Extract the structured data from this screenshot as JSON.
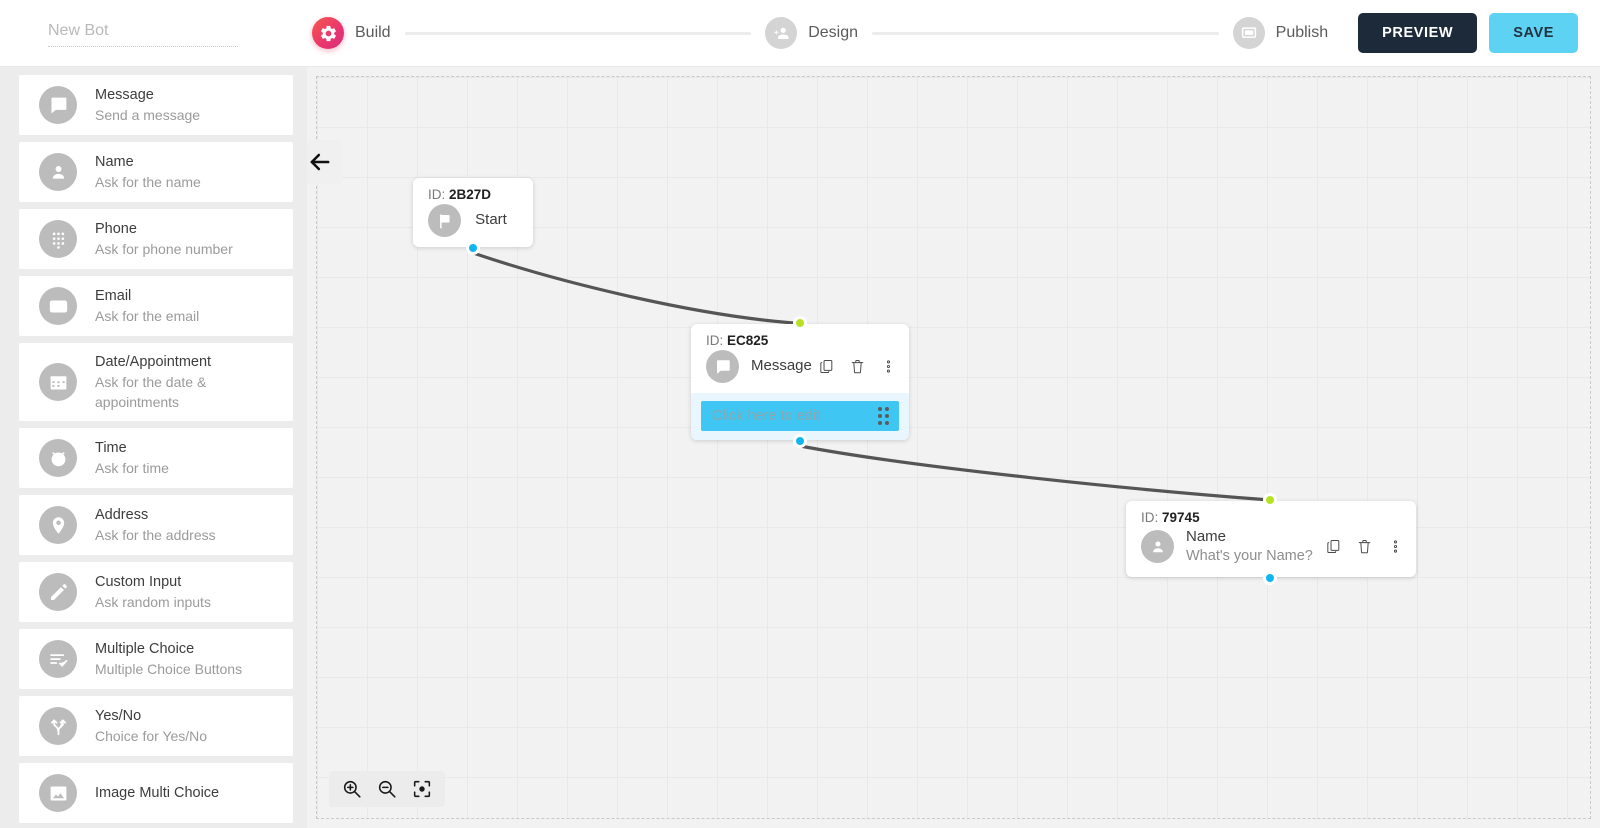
{
  "header": {
    "bot_name_value": "",
    "bot_name_placeholder": "New Bot",
    "steps": [
      {
        "label": "Build",
        "icon": "gear-icon",
        "state": "active"
      },
      {
        "label": "Design",
        "icon": "people-add-icon",
        "state": "idle"
      },
      {
        "label": "Publish",
        "icon": "monitor-icon",
        "state": "idle"
      }
    ],
    "preview_label": "PREVIEW",
    "save_label": "SAVE",
    "accent_active": "#e7365f",
    "preview_bg": "#1d2a3a",
    "save_bg": "#5dd2f3"
  },
  "sidebar": {
    "items": [
      {
        "title": "Message",
        "sub": "Send a message",
        "icon": "chat-bubble-icon"
      },
      {
        "title": "Name",
        "sub": "Ask for the name",
        "icon": "person-icon"
      },
      {
        "title": "Phone",
        "sub": "Ask for phone number",
        "icon": "dialpad-icon"
      },
      {
        "title": "Email",
        "sub": "Ask for the email",
        "icon": "envelope-icon"
      },
      {
        "title": "Date/Appointment",
        "sub": "Ask for the date & appointments",
        "icon": "calendar-icon"
      },
      {
        "title": "Time",
        "sub": "Ask for time",
        "icon": "alarm-clock-icon"
      },
      {
        "title": "Address",
        "sub": "Ask for the address",
        "icon": "map-pin-icon"
      },
      {
        "title": "Custom Input",
        "sub": "Ask random inputs",
        "icon": "pencil-icon"
      },
      {
        "title": "Multiple Choice",
        "sub": "Multiple Choice Buttons",
        "icon": "checklist-icon"
      },
      {
        "title": "Yes/No",
        "sub": "Choice for Yes/No",
        "icon": "fork-branch-icon"
      },
      {
        "title": "Image Multi Choice",
        "sub": "",
        "icon": "image-icon"
      }
    ]
  },
  "canvas": {
    "back_arrow": "back-arrow-icon",
    "id_prefix": "ID:",
    "nodes": [
      {
        "key": "start",
        "id": "2B27D",
        "title": "Start",
        "sub": "",
        "icon": "flag-icon",
        "has_tools": false
      },
      {
        "key": "message",
        "id": "EC825",
        "title": "Message",
        "sub": "",
        "icon": "chat-bubble-icon",
        "has_tools": true,
        "edit_placeholder": "Click here to edit",
        "edit_value": ""
      },
      {
        "key": "name",
        "id": "79745",
        "title": "Name",
        "sub": "What's your Name?",
        "icon": "person-icon",
        "has_tools": true
      }
    ],
    "tools": {
      "copy": "copy-icon",
      "delete": "trash-icon",
      "more": "more-vertical-icon"
    },
    "ports": {
      "out_color": "#11b5f0",
      "in_color": "#b6e223"
    },
    "edge_color": "#555555",
    "zoom_controls": [
      {
        "name": "zoom-in-icon"
      },
      {
        "name": "zoom-out-icon"
      },
      {
        "name": "fit-to-screen-icon"
      }
    ]
  }
}
